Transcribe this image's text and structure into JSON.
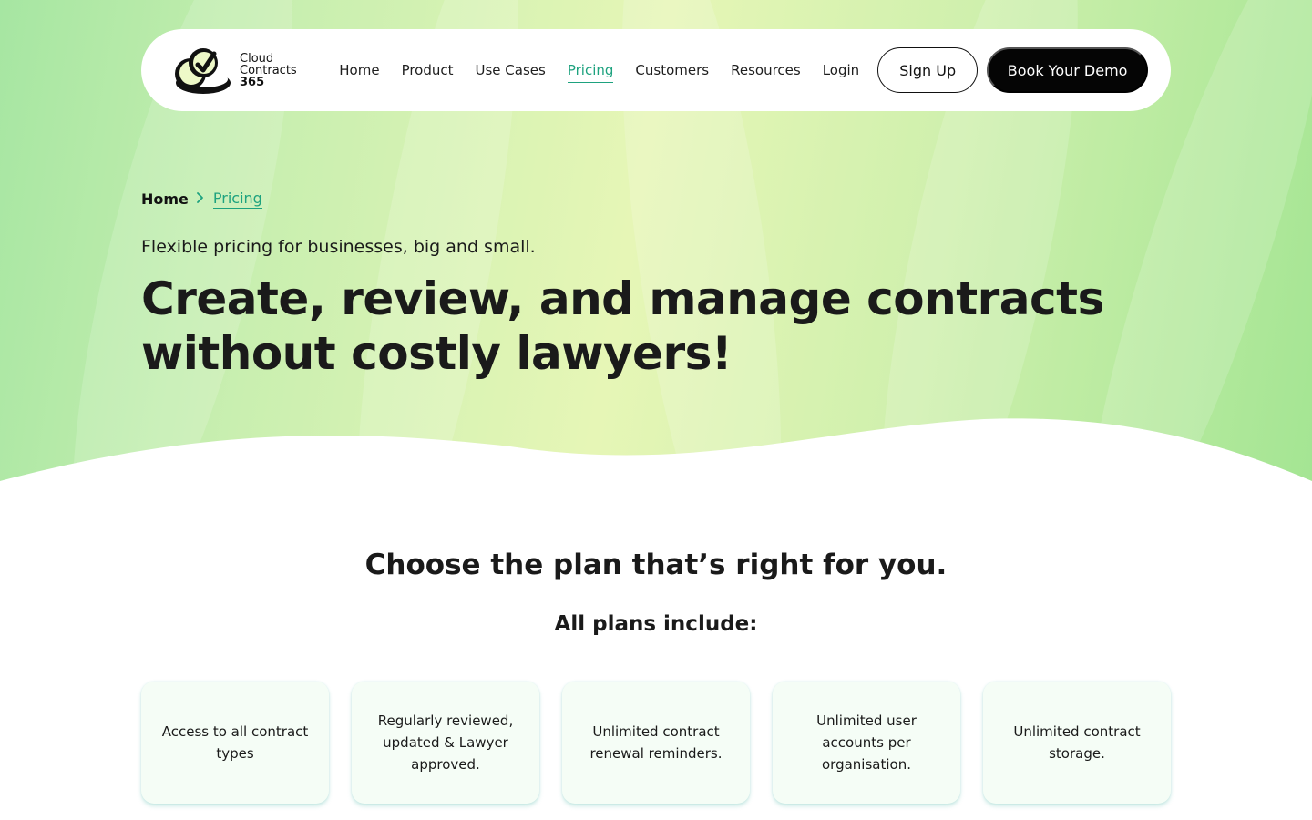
{
  "brand": {
    "name_line1": "Cloud",
    "name_line2": "Contracts",
    "name_line3": "365",
    "colors": {
      "accent": "#1ea27f",
      "dark": "#050505",
      "hero_green": "#a6e6a2",
      "hero_yellow": "#e6f6b6"
    }
  },
  "nav": {
    "links": [
      {
        "label": "Home"
      },
      {
        "label": "Product"
      },
      {
        "label": "Use Cases"
      },
      {
        "label": "Pricing"
      },
      {
        "label": "Customers"
      },
      {
        "label": "Resources"
      },
      {
        "label": "Login"
      }
    ],
    "active": "Pricing",
    "signup_label": "Sign Up",
    "demo_label": "Book Your Demo"
  },
  "breadcrumb": {
    "home": "Home",
    "separator_icon": "chevron-right-icon",
    "current": "Pricing"
  },
  "hero": {
    "subtitle": "Flexible pricing for businesses, big and small.",
    "headline": "Create, review, and manage contracts without costly lawyers!"
  },
  "plans": {
    "title": "Choose the plan that’s right for you.",
    "subtitle": "All plans include:",
    "features": [
      {
        "text": "Access to all contract types"
      },
      {
        "text": "Regularly reviewed, updated & Lawyer approved."
      },
      {
        "text": "Unlimited contract renewal reminders."
      },
      {
        "text": "Unlimited user accounts per organisation."
      },
      {
        "text": "Unlimited contract storage."
      }
    ]
  }
}
